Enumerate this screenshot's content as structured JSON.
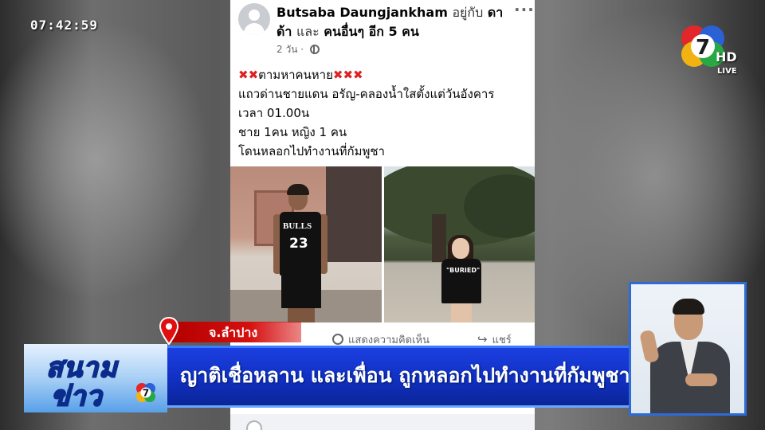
{
  "overlay": {
    "timestamp": "07:42:59",
    "channel_hd": "HD",
    "channel_live": "LIVE"
  },
  "post": {
    "author": "Butsaba Daungjankham",
    "with_prefix": "อยู่กับ",
    "with_name": "ดา",
    "with_name2": "ด้า",
    "and_text": "และ",
    "others": "คนอื่นๆ อีก 5 คน",
    "time_ago": "2 วัน",
    "more_label": "···",
    "text_line1": "ตามหาคนหาย",
    "text_line2": "แถวด่านชายแดน อรัญ-คลองน้ำใสตั้งแต่วันอังคาร",
    "text_line3": "เวลา 01.00น",
    "text_line4": "ชาย 1คน หญิง 1 คน",
    "text_line5": "โดนหลอกไปทำงานที่กัมพูชา",
    "photo1_shirt_text": "BULLS",
    "photo1_shirt_number": "23",
    "photo2_shirt_text": "\"BURIED\"",
    "comment_label": "แสดงความคิดเห็น",
    "share_label": "แชร์"
  },
  "location": {
    "label": "จ.ลำปาง"
  },
  "lower_third": {
    "brand_top": "สนาม",
    "brand_bottom": "ข่าว",
    "headline": "ญาติเชื่อหลาน และเพื่อน ถูกหลอกไปทำงานที่กัมพูชา"
  },
  "colors": {
    "headline_blue": "#1130c2",
    "location_red": "#d60f0f",
    "brand_outline": "#0b2c8a"
  }
}
